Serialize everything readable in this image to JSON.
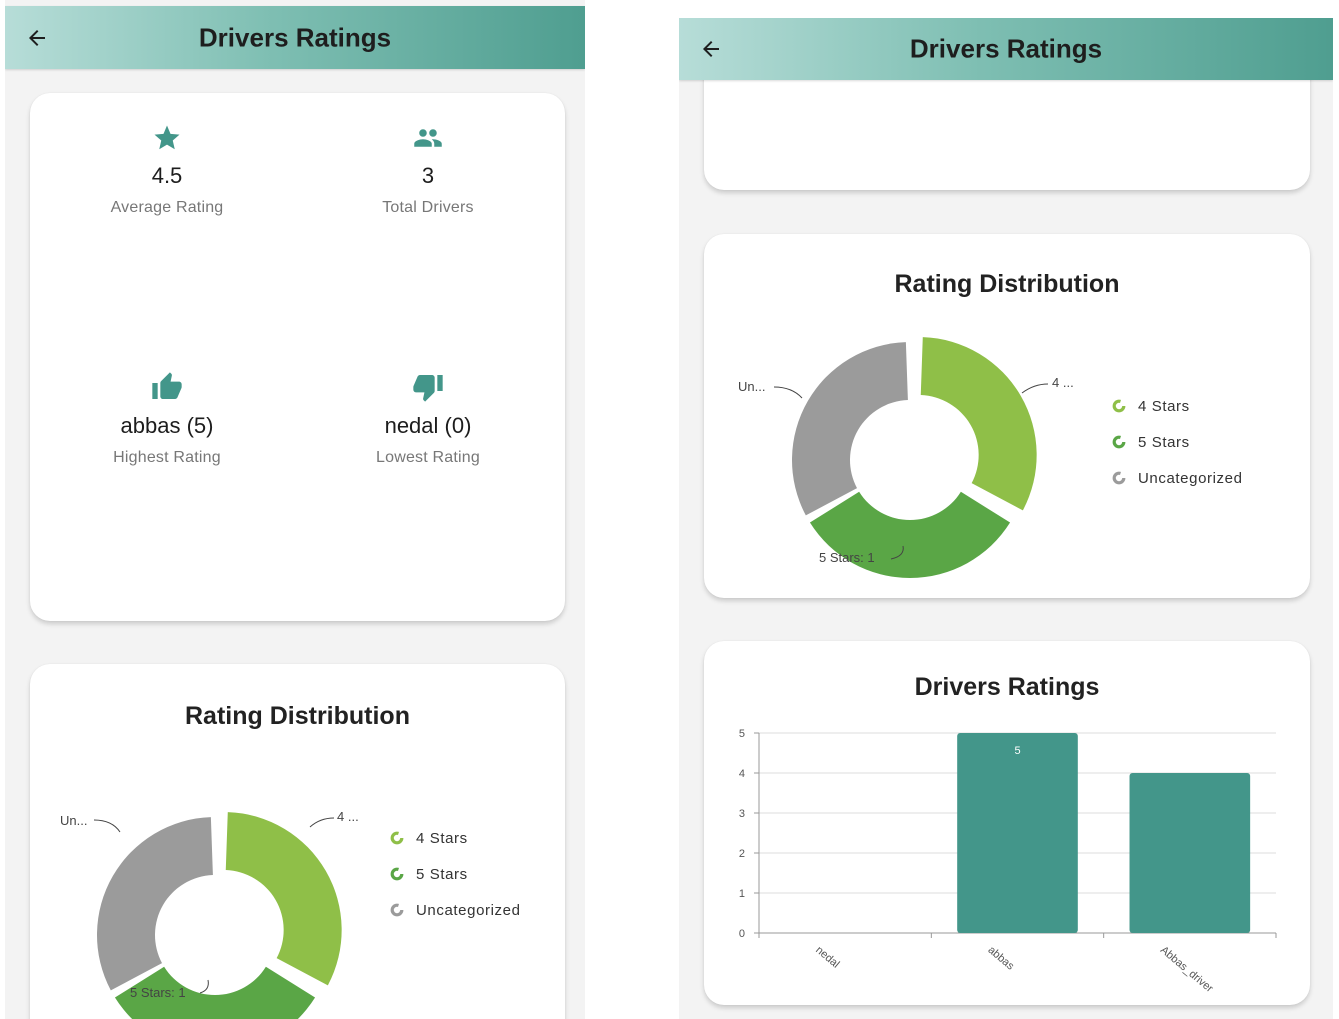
{
  "appbar": {
    "title": "Drivers Ratings",
    "back_icon": "arrow-left-icon"
  },
  "stats": {
    "average": {
      "icon": "star-icon",
      "value": "4.5",
      "label": "Average Rating"
    },
    "total": {
      "icon": "group-icon",
      "value": "3",
      "label": "Total Drivers"
    },
    "highest": {
      "icon": "thumb-up-icon",
      "value": "abbas (5)",
      "label": "Highest Rating"
    },
    "lowest": {
      "icon": "thumb-down-icon",
      "value": "nedal (0)",
      "label": "Lowest Rating"
    }
  },
  "distribution": {
    "title": "Rating Distribution",
    "label_4": "4 ...",
    "label_5": "5 Stars: 1",
    "label_un": "Un...",
    "legend": [
      {
        "label": "4 Stars",
        "color": "#8fbf48"
      },
      {
        "label": "5 Stars",
        "color": "#5aa646"
      },
      {
        "label": "Uncategorized",
        "color": "#9b9b9b"
      }
    ]
  },
  "chart_data": [
    {
      "type": "pie",
      "title": "Rating Distribution",
      "categories": [
        "4 Stars",
        "5 Stars",
        "Uncategorized"
      ],
      "values": [
        1,
        1,
        1
      ],
      "legend": "right"
    },
    {
      "type": "bar",
      "title": "Drivers Ratings",
      "categories": [
        "nedal",
        "abbas",
        "Abbas_driver"
      ],
      "values": [
        0,
        5,
        4
      ],
      "data_labels": [
        "",
        "5",
        ""
      ],
      "ylim": [
        0,
        5
      ],
      "yticks": [
        "0",
        "1",
        "2",
        "3",
        "4",
        "5"
      ],
      "grid": true,
      "color": "#43968a"
    }
  ],
  "colors": {
    "accent": "#43968a",
    "green_light": "#8fbf48",
    "green_dark": "#5aa646",
    "grey": "#9b9b9b"
  }
}
